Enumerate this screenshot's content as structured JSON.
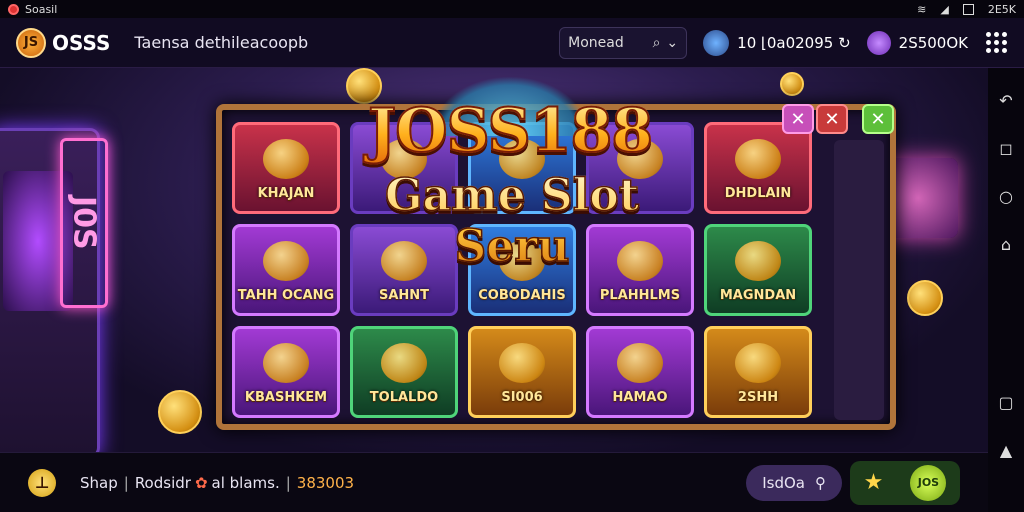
{
  "status_bar": {
    "app_name": "Soasil",
    "time": "2E5K"
  },
  "topbar": {
    "logo_text": "OSSS",
    "logo_badge": "JS",
    "page_title": "Taensa dethileacoopb",
    "search_value": "Monead",
    "balance_1": "10 ⌊0a02095 ↻",
    "balance_2": "2S500OK"
  },
  "banner": {
    "title": "JOSS188",
    "subtitle": "Game Slot Seru"
  },
  "tiles": [
    {
      "label": "KHAJAN",
      "color": "t-red"
    },
    {
      "label": "",
      "color": "t-purple"
    },
    {
      "label": "",
      "color": "t-blue"
    },
    {
      "label": "",
      "color": "t-purple"
    },
    {
      "label": "DHDLAIN",
      "color": "t-red"
    },
    {
      "label": "TAHH OCANG",
      "color": "t-violet"
    },
    {
      "label": "SAHNT",
      "color": "t-purple"
    },
    {
      "label": "COBODAHIS",
      "color": "t-blue"
    },
    {
      "label": "PLAHHLMS",
      "color": "t-violet"
    },
    {
      "label": "MAGNDAN",
      "color": "t-green"
    },
    {
      "label": "KBASHKEM",
      "color": "t-violet"
    },
    {
      "label": "TOLALDO",
      "color": "t-green"
    },
    {
      "label": "SI006",
      "color": "t-gold"
    },
    {
      "label": "HAMAO",
      "color": "t-violet"
    },
    {
      "label": "2SHH",
      "color": "t-gold"
    }
  ],
  "bottombar": {
    "label_1": "Shap",
    "label_2": "Rodsidr",
    "label_3": "al",
    "label_4": "blams.",
    "jackpot": "383003",
    "pill_label": "IsdOa",
    "spin_label": "JOS"
  },
  "icons": {
    "wifi": "wifi-icon",
    "signal": "signal-icon",
    "battery": "battery-icon",
    "search": "search-icon",
    "dropdown": "chevron-down-icon",
    "menu": "grid-menu-icon",
    "back": "back-icon",
    "home": "home-icon",
    "circle": "circle-icon",
    "house": "house-icon",
    "recent": "recent-apps-icon"
  },
  "colors": {
    "accent_gold": "#ffb01c",
    "frame": "#b0743a",
    "bg": "#0b0716"
  }
}
